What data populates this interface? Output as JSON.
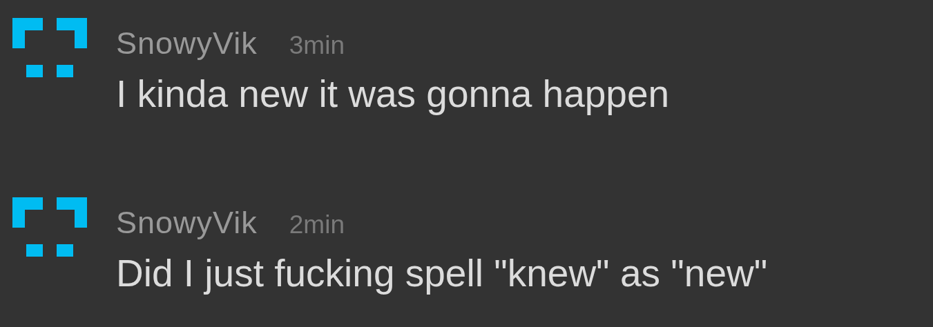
{
  "messages": [
    {
      "author": "SnowyVik",
      "time": "3min",
      "text": "I kinda new it was gonna happen"
    },
    {
      "author": "SnowyVik",
      "time": "2min",
      "text": "Did I just fucking spell \"knew\" as \"new\""
    }
  ]
}
